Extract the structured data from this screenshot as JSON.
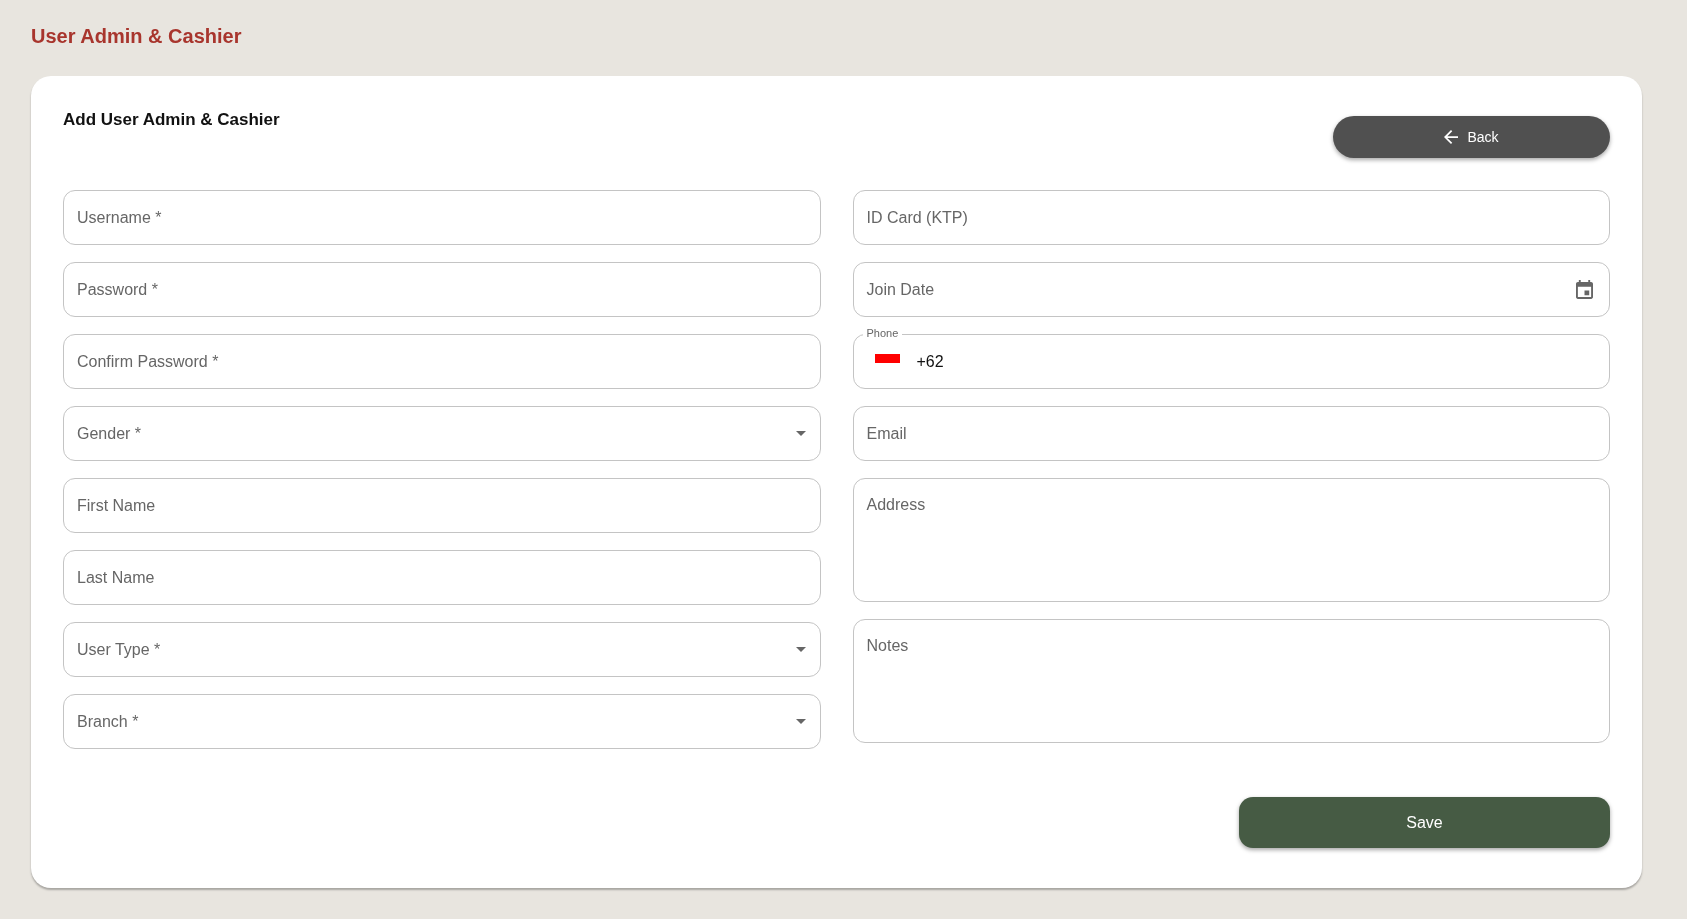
{
  "page": {
    "title": "User Admin & Cashier"
  },
  "form": {
    "title": "Add User Admin & Cashier",
    "back_button": "Back",
    "left_fields": [
      {
        "kind": "text",
        "placeholder": "Username *"
      },
      {
        "kind": "password",
        "placeholder": "Password *"
      },
      {
        "kind": "password",
        "placeholder": "Confirm Password *"
      },
      {
        "kind": "select",
        "placeholder": "Gender *"
      },
      {
        "kind": "text",
        "placeholder": "First Name"
      },
      {
        "kind": "text",
        "placeholder": "Last Name"
      },
      {
        "kind": "select",
        "placeholder": "User Type *"
      },
      {
        "kind": "select",
        "placeholder": "Branch *"
      }
    ],
    "right_fields": [
      {
        "kind": "text",
        "placeholder": "ID Card (KTP)"
      },
      {
        "kind": "date",
        "placeholder": "Join Date"
      },
      {
        "kind": "phone",
        "label": "Phone",
        "value": "+62"
      },
      {
        "kind": "text",
        "placeholder": "Email"
      },
      {
        "kind": "textarea",
        "placeholder": "Address"
      },
      {
        "kind": "textarea",
        "placeholder": "Notes"
      }
    ],
    "save_button": "Save"
  }
}
